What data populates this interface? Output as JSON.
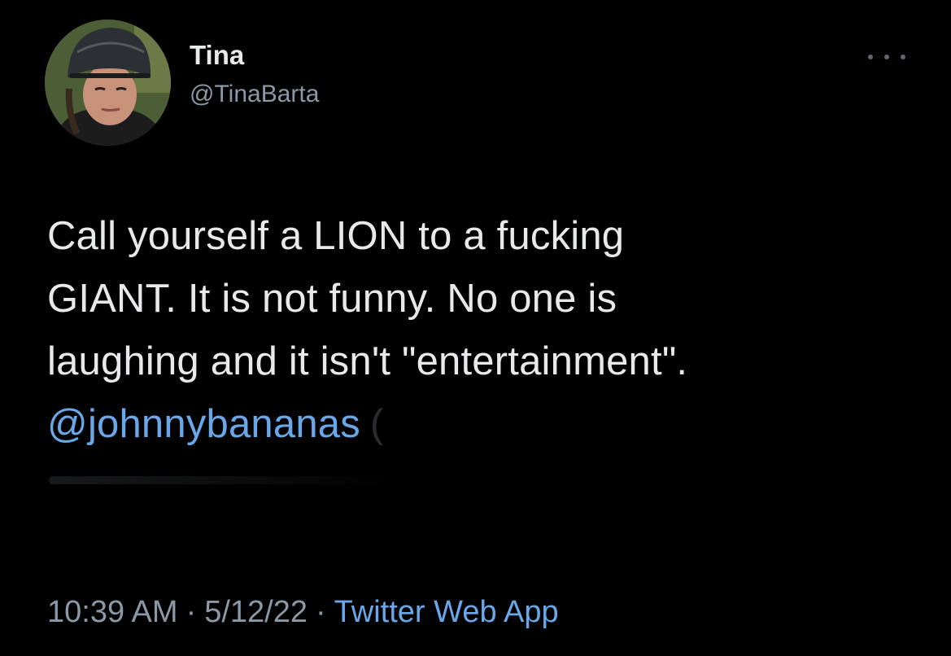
{
  "tweet": {
    "author": {
      "display_name": "Tina",
      "handle": "@TinaBarta",
      "avatar_icon": "profile-photo-helmet"
    },
    "more_icon": "ellipsis-icon",
    "body_lines": [
      "Call yourself a LION to a fucking",
      "GIANT. It is not funny.  No one is",
      "laughing and it isn't \"entertainment\"."
    ],
    "mention": "@johnnybananas",
    "time": "10:39 AM",
    "date": "5/12/22",
    "separator": "·",
    "source": "Twitter Web App"
  },
  "colors": {
    "background": "#000000",
    "text_primary": "#e7e9ea",
    "text_secondary": "#8b98a5",
    "link": "#6aa7e8"
  }
}
